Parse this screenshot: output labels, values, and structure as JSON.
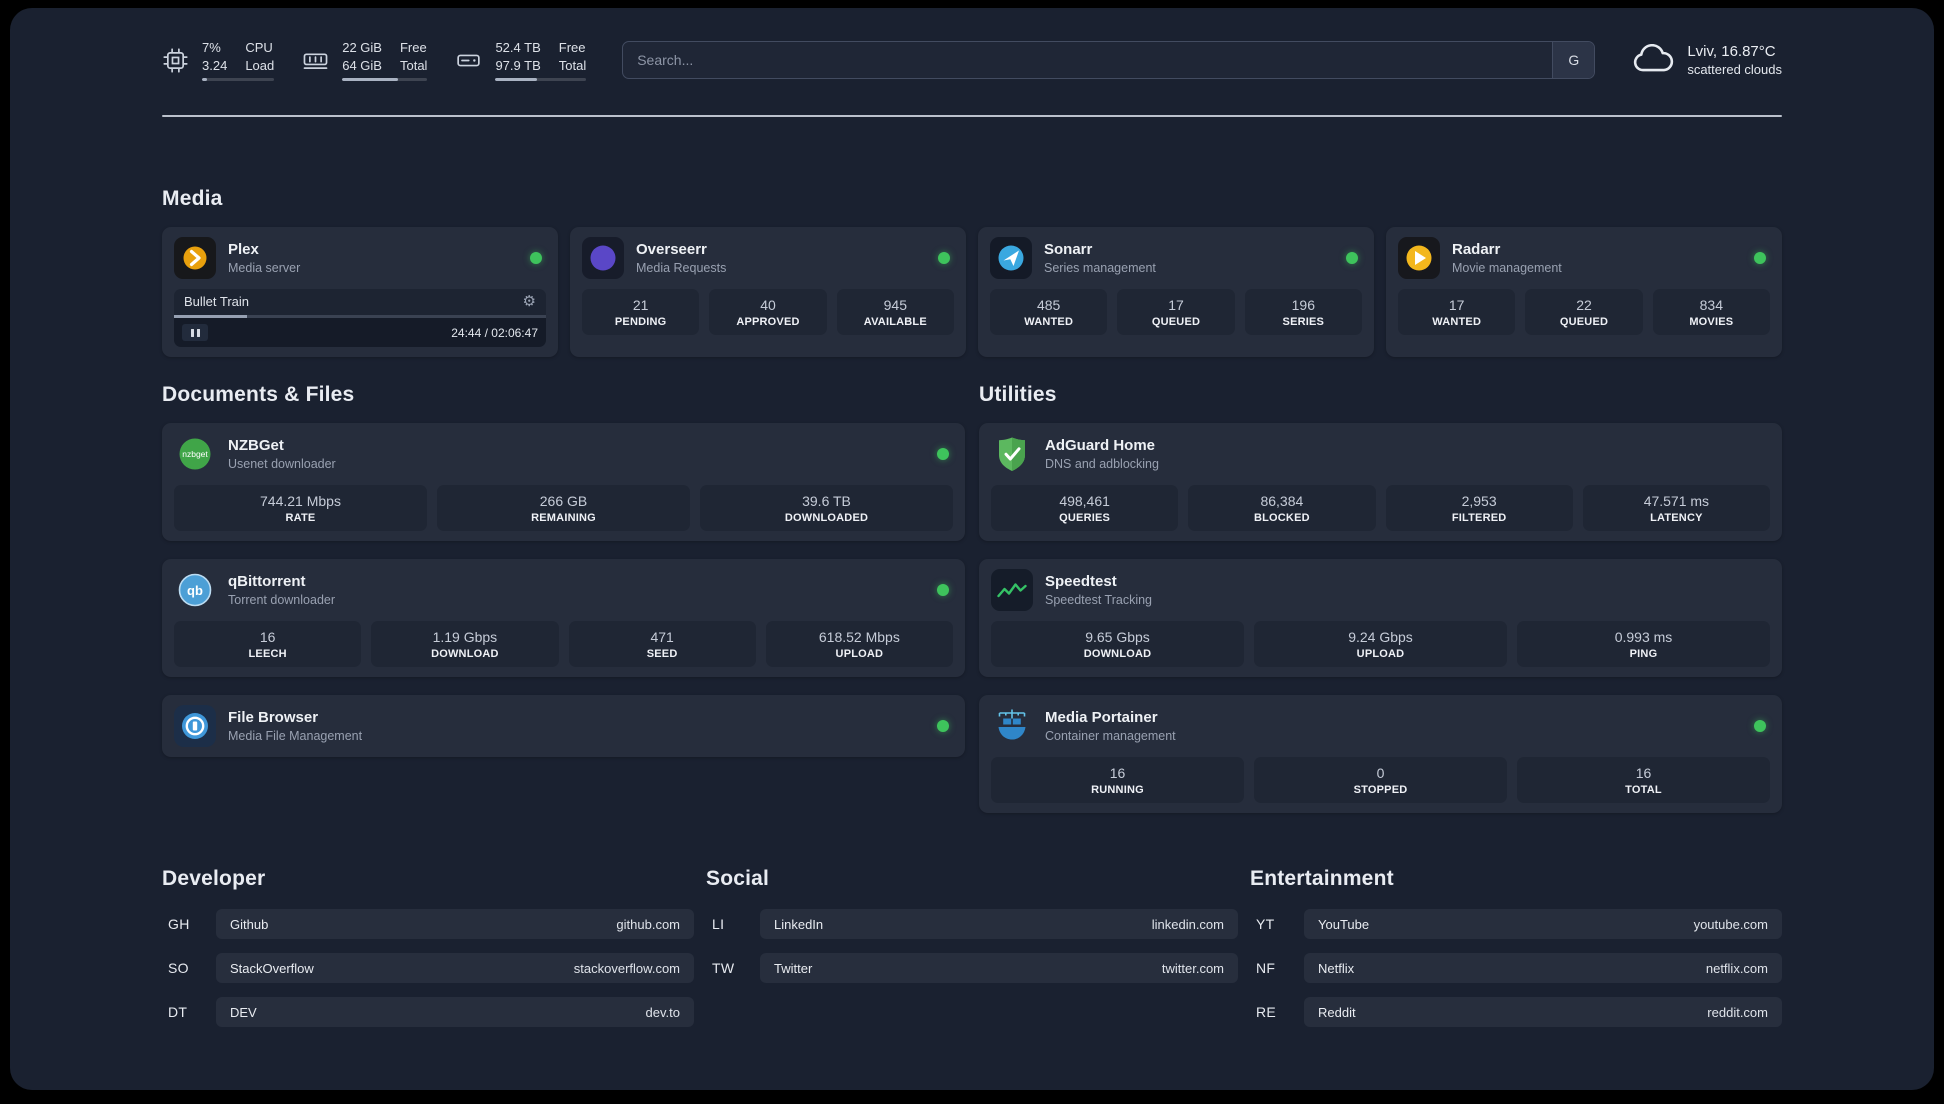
{
  "colors": {
    "background": "#1a2130",
    "card": "#262d3c",
    "stat_box": "#1f2634",
    "status_online": "#3ec35c",
    "plex_brand": "#e8a00d",
    "overseerr_brand": "#5a47c7",
    "sonarr_brand": "#3aa8e0",
    "radarr_brand": "#f3b71d",
    "nzbget_brand": "#40a548",
    "qbittorrent_brand": "#4c9fd6",
    "filebrowser_brand": "#3f97d9",
    "adguard_brand": "#5cb85f",
    "speedtest_brand": "#35c266",
    "portainer_brand": "#2f86c9"
  },
  "topbar": {
    "cpu": {
      "icon": "cpu-chip-icon",
      "value_top": "7%",
      "value_bottom": "3.24",
      "label_top": "CPU",
      "label_bottom": "Load",
      "progress_percent": 7
    },
    "ram": {
      "icon": "memory-icon",
      "value_top": "22 GiB",
      "value_bottom": "64 GiB",
      "label_top": "Free",
      "label_bottom": "Total",
      "progress_percent": 66
    },
    "disk": {
      "icon": "disk-icon",
      "value_top": "52.4 TB",
      "value_bottom": "97.9 TB",
      "label_top": "Free",
      "label_bottom": "Total",
      "progress_percent": 46
    },
    "search": {
      "placeholder": "Search...",
      "engine_label": "G"
    },
    "weather": {
      "icon": "cloud-icon",
      "location": "Lviv, 16.87°C",
      "condition": "scattered clouds"
    }
  },
  "sections": {
    "media": "Media",
    "documents": "Documents & Files",
    "utilities": "Utilities",
    "developer": "Developer",
    "social": "Social",
    "entertainment": "Entertainment"
  },
  "media_cards": [
    {
      "name": "Plex",
      "subtitle": "Media server",
      "online": true,
      "player": {
        "title": "Bullet Train",
        "time": "24:44 / 02:06:47",
        "progress_percent": 19.5
      }
    },
    {
      "name": "Overseerr",
      "subtitle": "Media Requests",
      "online": true,
      "stats": [
        {
          "value": "21",
          "label": "PENDING"
        },
        {
          "value": "40",
          "label": "APPROVED"
        },
        {
          "value": "945",
          "label": "AVAILABLE"
        }
      ]
    },
    {
      "name": "Sonarr",
      "subtitle": "Series management",
      "online": true,
      "stats": [
        {
          "value": "485",
          "label": "WANTED"
        },
        {
          "value": "17",
          "label": "QUEUED"
        },
        {
          "value": "196",
          "label": "SERIES"
        }
      ]
    },
    {
      "name": "Radarr",
      "subtitle": "Movie management",
      "online": true,
      "stats": [
        {
          "value": "17",
          "label": "WANTED"
        },
        {
          "value": "22",
          "label": "QUEUED"
        },
        {
          "value": "834",
          "label": "MOVIES"
        }
      ]
    }
  ],
  "documents_cards": [
    {
      "name": "NZBGet",
      "subtitle": "Usenet downloader",
      "online": true,
      "stats": [
        {
          "value": "744.21 Mbps",
          "label": "RATE"
        },
        {
          "value": "266 GB",
          "label": "REMAINING"
        },
        {
          "value": "39.6 TB",
          "label": "DOWNLOADED"
        }
      ]
    },
    {
      "name": "qBittorrent",
      "subtitle": "Torrent downloader",
      "online": true,
      "stats": [
        {
          "value": "16",
          "label": "LEECH"
        },
        {
          "value": "1.19 Gbps",
          "label": "DOWNLOAD"
        },
        {
          "value": "471",
          "label": "SEED"
        },
        {
          "value": "618.52 Mbps",
          "label": "UPLOAD"
        }
      ]
    },
    {
      "name": "File Browser",
      "subtitle": "Media File Management",
      "online": true
    }
  ],
  "utilities_cards": [
    {
      "name": "AdGuard Home",
      "subtitle": "DNS and adblocking",
      "stats": [
        {
          "value": "498,461",
          "label": "QUERIES"
        },
        {
          "value": "86,384",
          "label": "BLOCKED"
        },
        {
          "value": "2,953",
          "label": "FILTERED"
        },
        {
          "value": "47.571 ms",
          "label": "LATENCY"
        }
      ]
    },
    {
      "name": "Speedtest",
      "subtitle": "Speedtest Tracking",
      "stats": [
        {
          "value": "9.65 Gbps",
          "label": "DOWNLOAD"
        },
        {
          "value": "9.24 Gbps",
          "label": "UPLOAD"
        },
        {
          "value": "0.993 ms",
          "label": "PING"
        }
      ]
    },
    {
      "name": "Media Portainer",
      "subtitle": "Container management",
      "online": true,
      "stats": [
        {
          "value": "16",
          "label": "RUNNING"
        },
        {
          "value": "0",
          "label": "STOPPED"
        },
        {
          "value": "16",
          "label": "TOTAL"
        }
      ]
    }
  ],
  "bookmarks": {
    "developer": [
      {
        "abbr": "GH",
        "name": "Github",
        "url": "github.com"
      },
      {
        "abbr": "SO",
        "name": "StackOverflow",
        "url": "stackoverflow.com"
      },
      {
        "abbr": "DT",
        "name": "DEV",
        "url": "dev.to"
      }
    ],
    "social": [
      {
        "abbr": "LI",
        "name": "LinkedIn",
        "url": "linkedin.com"
      },
      {
        "abbr": "TW",
        "name": "Twitter",
        "url": "twitter.com"
      }
    ],
    "entertainment": [
      {
        "abbr": "YT",
        "name": "YouTube",
        "url": "youtube.com"
      },
      {
        "abbr": "NF",
        "name": "Netflix",
        "url": "netflix.com"
      },
      {
        "abbr": "RE",
        "name": "Reddit",
        "url": "reddit.com"
      }
    ]
  }
}
